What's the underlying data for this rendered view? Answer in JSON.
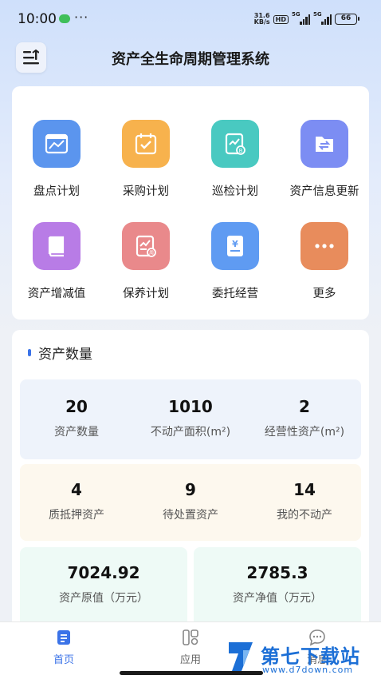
{
  "status_bar": {
    "time": "10:00",
    "dots": "···",
    "net_speed_value": "31.6",
    "net_speed_unit": "KB/s",
    "hd": "HD",
    "sig1_label": "5G",
    "sig2_label": "5G",
    "battery": "66"
  },
  "header": {
    "title": "资产全生命周期管理系统",
    "menu_icon": "menu-collapse-icon"
  },
  "grid": [
    {
      "label": "盘点计划",
      "icon": "inventory-chart-icon",
      "color": "#5b95ee"
    },
    {
      "label": "采购计划",
      "icon": "calendar-check-icon",
      "color": "#f7b24d"
    },
    {
      "label": "巡检计划",
      "icon": "inspection-report-icon",
      "color": "#49c9c1"
    },
    {
      "label": "资产信息更新",
      "icon": "folder-swap-icon",
      "color": "#7c8df3"
    },
    {
      "label": "资产增减值",
      "icon": "book-icon",
      "color": "#b87ce6"
    },
    {
      "label": "保养计划",
      "icon": "maintenance-chart-icon",
      "color": "#e9898b"
    },
    {
      "label": "委托经营",
      "icon": "yuan-document-icon",
      "color": "#5f9bf2"
    },
    {
      "label": "更多",
      "icon": "more-dots-icon",
      "color": "#e88c5c"
    }
  ],
  "stats": {
    "section_title": "资产数量",
    "row1": [
      {
        "value": "20",
        "caption": "资产数量"
      },
      {
        "value": "1010",
        "caption": "不动产面积(m²)"
      },
      {
        "value": "2",
        "caption": "经营性资产(m²)"
      }
    ],
    "row2": [
      {
        "value": "4",
        "caption": "质抵押资产"
      },
      {
        "value": "9",
        "caption": "待处置资产"
      },
      {
        "value": "14",
        "caption": "我的不动产"
      }
    ],
    "row3": [
      {
        "value": "7024.92",
        "caption": "资产原值（万元）"
      },
      {
        "value": "2785.3",
        "caption": "资产净值（万元）"
      }
    ],
    "colors": {
      "row1_bg": "#eef3fb",
      "row2_bg": "#fdf8ee",
      "row3_bg": "#eefaf6"
    }
  },
  "bottom_nav": [
    {
      "label": "首页",
      "icon": "home-doc-icon",
      "active": true
    },
    {
      "label": "应用",
      "icon": "apps-grid-icon",
      "active": false
    },
    {
      "label": "消息",
      "icon": "message-bubble-icon",
      "active": false
    }
  ],
  "watermark": {
    "text": "第七下载站",
    "url": "www.d7down.com"
  },
  "accent_color": "#3b73e8"
}
